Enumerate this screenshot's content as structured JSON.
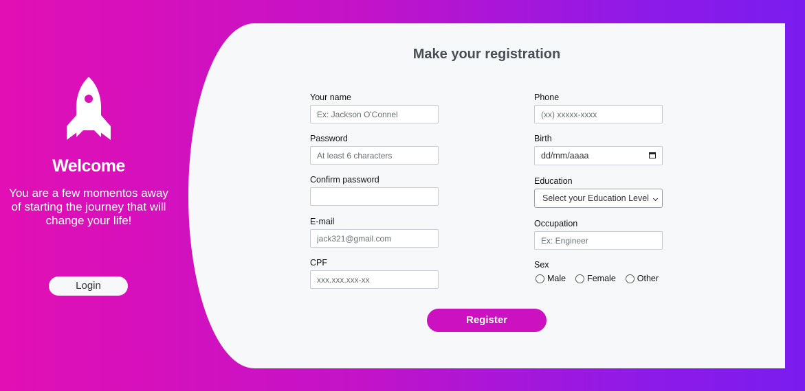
{
  "left_panel": {
    "rocket_icon": "rocket-icon",
    "welcome": "Welcome",
    "tagline": "You are a few momentos away of starting the journey that will change your life!",
    "login_label": "Login"
  },
  "form": {
    "title": "Make your registration",
    "name": {
      "label": "Your name",
      "placeholder": "Ex: Jackson O'Connel"
    },
    "password": {
      "label": "Password",
      "placeholder": "At least 6 characters"
    },
    "confirm_password": {
      "label": "Confirm password",
      "placeholder": ""
    },
    "email": {
      "label": "E-mail",
      "placeholder": "jack321@gmail.com"
    },
    "cpf": {
      "label": "CPF",
      "placeholder": "xxx.xxx.xxx-xx"
    },
    "phone": {
      "label": "Phone",
      "placeholder": "(xx) xxxxx-xxxx"
    },
    "birth": {
      "label": "Birth",
      "value": "dd/mm/aaaa",
      "icon": "calendar-icon"
    },
    "education": {
      "label": "Education",
      "selected": "Select your Education Level"
    },
    "occupation": {
      "label": "Occupation",
      "placeholder": "Ex: Engineer"
    },
    "sex": {
      "label": "Sex",
      "options": [
        "Male",
        "Female",
        "Other"
      ]
    },
    "register_label": "Register"
  },
  "colors": {
    "gradient_start": "#e20fb4",
    "gradient_end": "#7a1cef",
    "register_button": "#cb11c0",
    "card_background": "#f6f8fa"
  }
}
